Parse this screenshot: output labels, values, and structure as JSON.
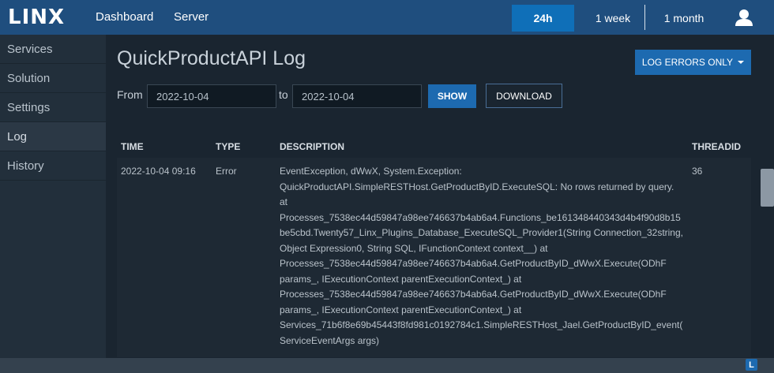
{
  "header": {
    "logo": "LINX",
    "nav": [
      "Dashboard",
      "Server"
    ],
    "ranges": [
      "24h",
      "1 week",
      "1 month"
    ],
    "active_range": "24h"
  },
  "sidebar": {
    "items": [
      {
        "label": "Services"
      },
      {
        "label": "Solution"
      },
      {
        "label": "Settings"
      },
      {
        "label": "Log"
      },
      {
        "label": "History"
      }
    ],
    "active": "Log"
  },
  "page": {
    "title": "QuickProductAPI Log",
    "errors_button": "LOG ERRORS ONLY"
  },
  "filter": {
    "from_label": "From",
    "from_value": "2022-10-04",
    "to_label": "to",
    "to_value": "2022-10-04",
    "show_label": "SHOW",
    "download_label": "DOWNLOAD"
  },
  "table": {
    "headers": [
      "TIME",
      "TYPE",
      "DESCRIPTION",
      "THREADID"
    ],
    "rows": [
      {
        "time": "2022-10-04 09:16",
        "type": "Error",
        "description": "EventException, dWwX, System.Exception: QuickProductAPI.SimpleRESTHost.GetProductByID.ExecuteSQL: No rows returned by query. at Processes_7538ec44d59847a98ee746637b4ab6a4.Functions_be161348440343d4b4f90d8b15be5cbd.Twenty57_Linx_Plugins_Database_ExecuteSQL_Provider1(String Connection_32string, Object Expression0, String SQL, IFunctionContext context__) at Processes_7538ec44d59847a98ee746637b4ab6a4.GetProductByID_dWwX.Execute(ODhF params_, IExecutionContext parentExecutionContext_) at Processes_7538ec44d59847a98ee746637b4ab6a4.GetProductByID_dWwX.Execute(ODhF params_, IExecutionContext parentExecutionContext_) at Services_71b6f8e69b45443f8fd981c0192784c1.SimpleRESTHost_Jael.GetProductByID_event(ServiceEventArgs args)",
        "threadid": "36"
      }
    ]
  },
  "colors": {
    "header_bg": "#1f4e7e",
    "accent": "#1d6ab0",
    "page_bg": "#1a2530",
    "sidebar_bg": "#222f3b"
  },
  "icons": {
    "user": "user-icon",
    "caret": "chevron-down-icon",
    "corner": "linx-icon"
  }
}
